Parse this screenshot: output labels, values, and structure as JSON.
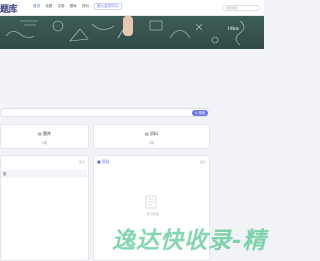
{
  "header": {
    "logo": "题库",
    "nav": [
      "首页",
      "真题",
      "试卷",
      "题库",
      "资料",
      "进入会员中心"
    ],
    "search_placeholder": "搜索题目"
  },
  "banner": {
    "chalk_text": "Idea"
  },
  "search": {
    "placeholder": "",
    "button_label": "Q 搜索"
  },
  "stats": [
    {
      "title": "题库",
      "sub": "0题"
    },
    {
      "title": "资料",
      "sub": "0篇"
    }
  ],
  "panels": {
    "left": {
      "more": "更多",
      "row_text": "推"
    },
    "right": {
      "title": "■ 资料",
      "more": "更多",
      "empty_text": "暂无数据"
    }
  },
  "watermark": "逸达快收录-精"
}
